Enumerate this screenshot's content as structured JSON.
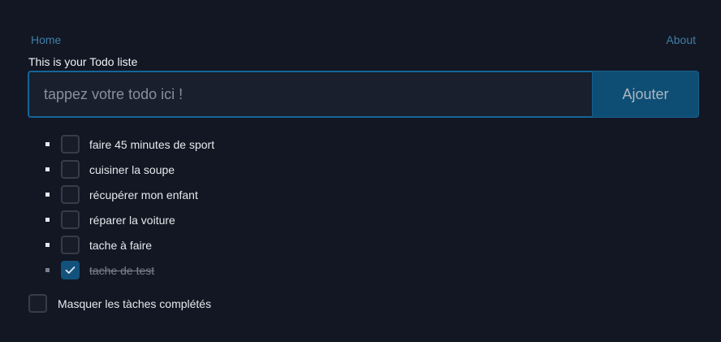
{
  "nav": {
    "home": "Home",
    "about": "About"
  },
  "page": {
    "title": "This is your Todo liste"
  },
  "form": {
    "placeholder": "tappez votre todo ici !",
    "value": "",
    "submit_label": "Ajouter"
  },
  "todos": [
    {
      "label": "faire 45 minutes de sport",
      "done": false
    },
    {
      "label": "cuisiner la soupe",
      "done": false
    },
    {
      "label": "récupérer mon enfant",
      "done": false
    },
    {
      "label": "réparer la voiture",
      "done": false
    },
    {
      "label": "tache à faire",
      "done": false
    },
    {
      "label": "tache de test",
      "done": true
    }
  ],
  "filter": {
    "hide_completed_label": "Masquer les tàches complétés",
    "hide_completed": false
  },
  "icons": {
    "checkmark": "checkmark-icon",
    "bullet": "bullet-icon"
  },
  "colors": {
    "background": "#121723",
    "accent": "#15649a",
    "button": "#0f4e74",
    "link": "#3f7ea6"
  }
}
